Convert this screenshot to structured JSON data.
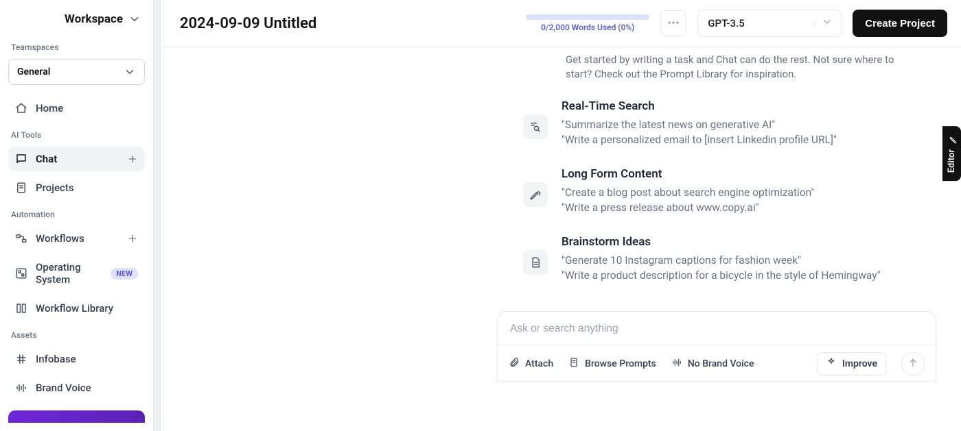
{
  "sidebar": {
    "workspace_label": "Workspace",
    "section_teamspaces": "Teamspaces",
    "teamspace_selected": "General",
    "home_label": "Home",
    "section_ai_tools": "AI Tools",
    "chat_label": "Chat",
    "projects_label": "Projects",
    "section_automation": "Automation",
    "workflows_label": "Workflows",
    "operating_system_label": "Operating System",
    "operating_system_badge": "NEW",
    "workflow_library_label": "Workflow Library",
    "section_assets": "Assets",
    "infobase_label": "Infobase",
    "brand_voice_label": "Brand Voice"
  },
  "topbar": {
    "doc_title": "2024-09-09 Untitled",
    "usage_text": "0/2,000 Words Used (0%)",
    "model_selected": "GPT-3.5",
    "create_project_label": "Create Project"
  },
  "intro": "Get started by writing a task and Chat can do the rest. Not sure where to start? Check out the Prompt Library for inspiration.",
  "cards": [
    {
      "title": "Real-Time Search",
      "line1": "\"Summarize the latest news on generative AI\"",
      "line2": "\"Write a personalized email to [insert Linkedin profile URL]\""
    },
    {
      "title": "Long Form Content",
      "line1": "\"Create a blog post about search engine optimization\"",
      "line2": "\"Write a press release about www.copy.ai\""
    },
    {
      "title": "Brainstorm Ideas",
      "line1": "\"Generate 10 Instagram captions for fashion week\"",
      "line2": "\"Write a product description for a bicycle in the style of Hemingway\""
    }
  ],
  "input": {
    "placeholder": "Ask or search anything",
    "attach_label": "Attach",
    "browse_prompts_label": "Browse Prompts",
    "no_brand_voice_label": "No Brand Voice",
    "improve_label": "Improve"
  },
  "editor_tab": "Editor"
}
